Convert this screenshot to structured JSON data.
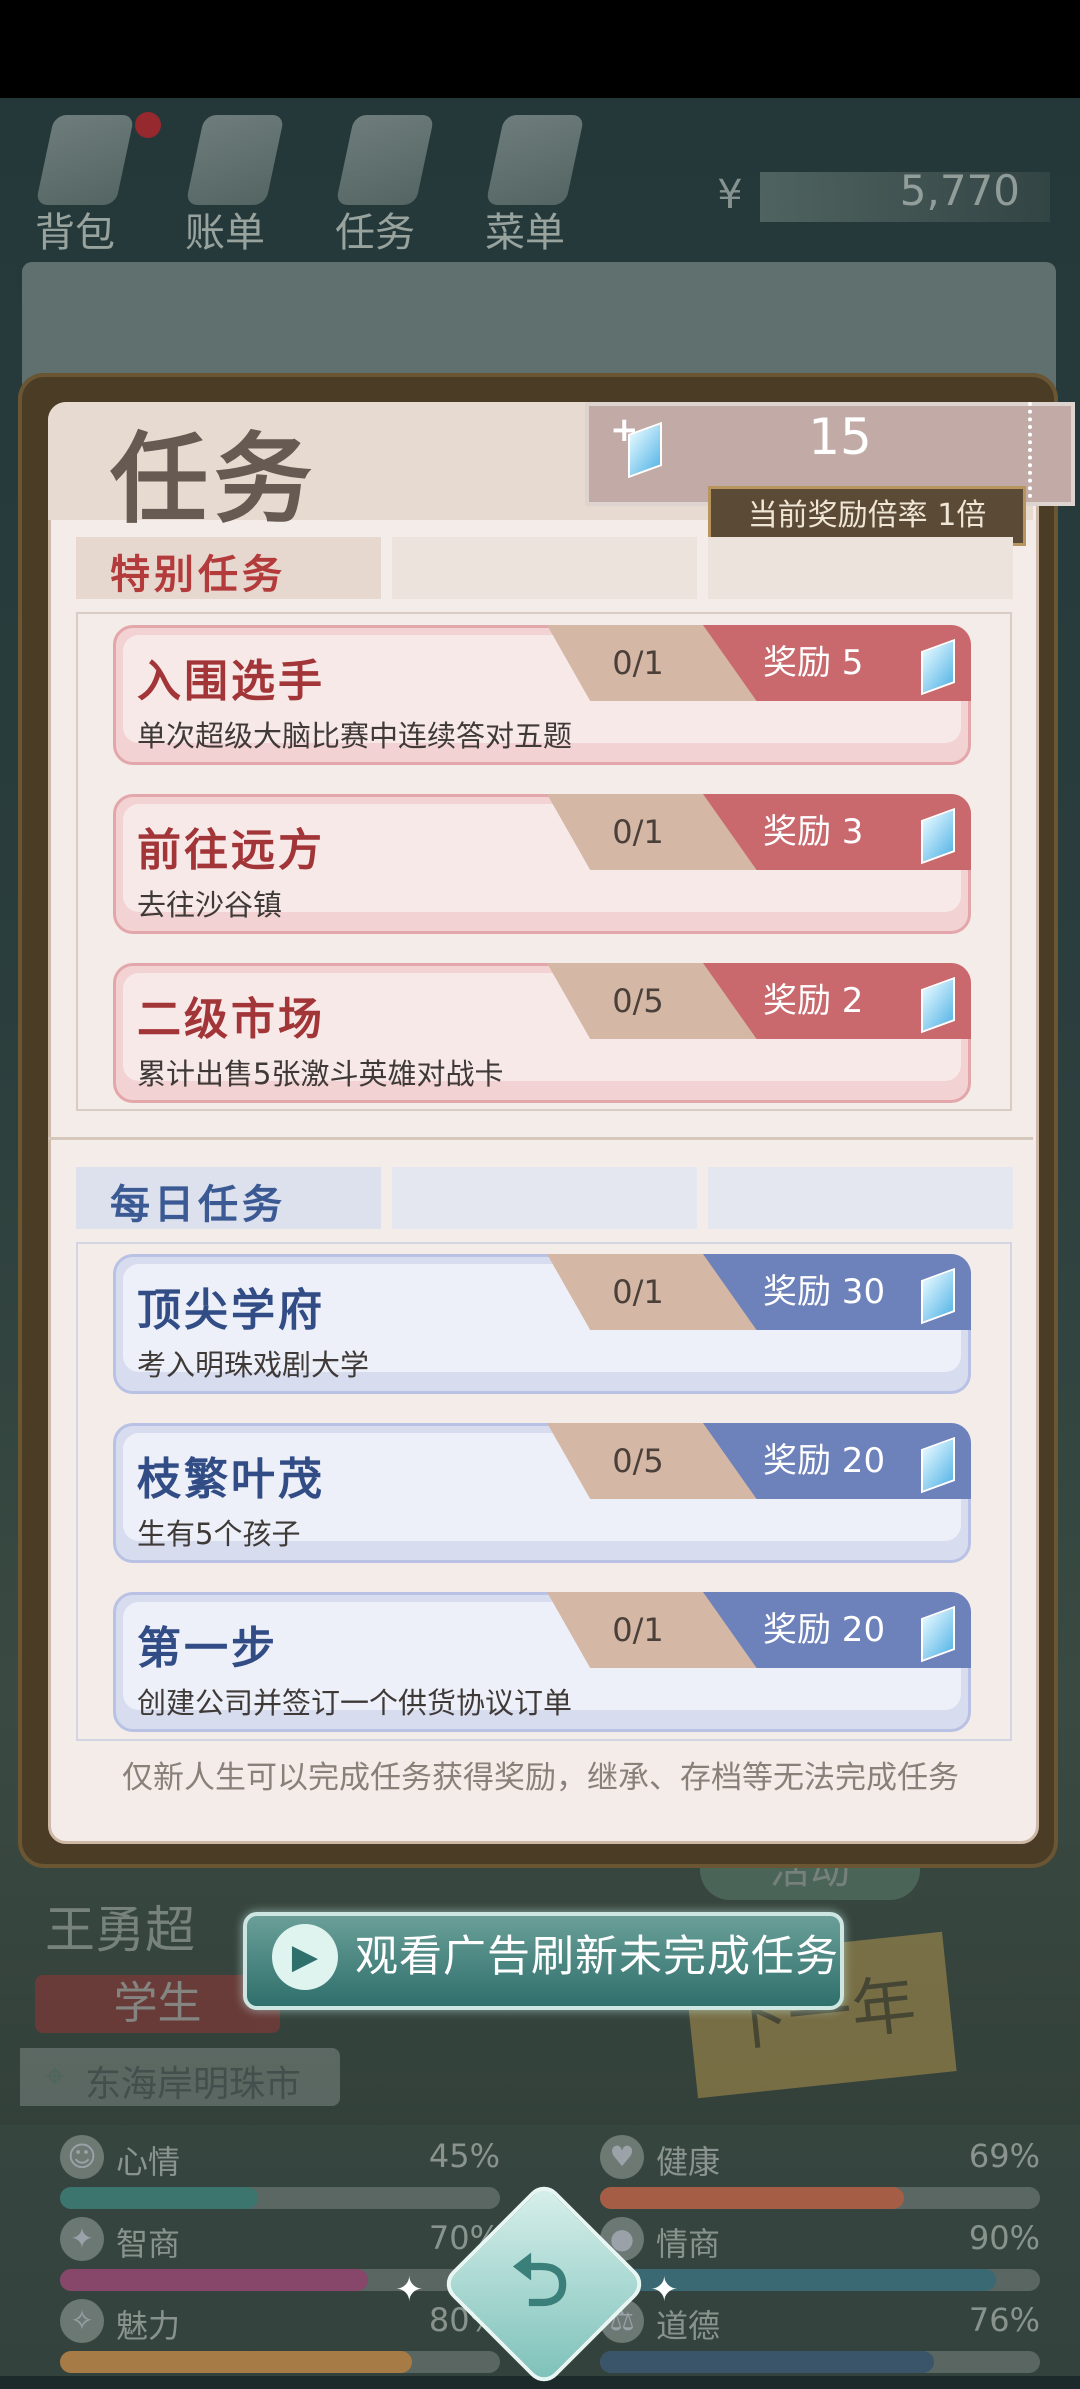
{
  "topnav": {
    "items": [
      {
        "label": "背包"
      },
      {
        "label": "账单"
      },
      {
        "label": "任务"
      },
      {
        "label": "菜单"
      }
    ],
    "money_symbol": "¥",
    "money_value": "5,770"
  },
  "background": {
    "name": "王勇超",
    "role": "学生",
    "location": "东海岸明珠市",
    "activity": "活动",
    "next_year": "下一年",
    "stats": [
      {
        "label": "心情",
        "value": "45%",
        "fraction": 0.45,
        "color": "#2f7a73"
      },
      {
        "label": "健康",
        "value": "69%",
        "fraction": 0.69,
        "color": "#c45a3a"
      },
      {
        "label": "智商",
        "value": "70%",
        "fraction": 0.7,
        "color": "#9a3b6e"
      },
      {
        "label": "情商",
        "value": "90%",
        "fraction": 0.9,
        "color": "#2e6a7a"
      },
      {
        "label": "魅力",
        "value": "80%",
        "fraction": 0.8,
        "color": "#c7853a"
      },
      {
        "label": "道德",
        "value": "76%",
        "fraction": 0.76,
        "color": "#2d4f6e"
      }
    ]
  },
  "modal": {
    "title": "任务",
    "gem_count": "15",
    "gem_plus": "+",
    "multiplier_text": "当前奖励倍率 1倍",
    "special_title": "特别任务",
    "daily_title": "每日任务",
    "special_tasks": [
      {
        "name": "入围选手",
        "desc": "单次超级大脑比赛中连续答对五题",
        "progress": "0/1",
        "reward": "奖励 5"
      },
      {
        "name": "前往远方",
        "desc": "去往沙谷镇",
        "progress": "0/1",
        "reward": "奖励 3"
      },
      {
        "name": "二级市场",
        "desc": "累计出售5张激斗英雄对战卡",
        "progress": "0/5",
        "reward": "奖励 2"
      }
    ],
    "daily_tasks": [
      {
        "name": "顶尖学府",
        "desc": "考入明珠戏剧大学",
        "progress": "0/1",
        "reward": "奖励 30"
      },
      {
        "name": "枝繁叶茂",
        "desc": "生有5个孩子",
        "progress": "0/5",
        "reward": "奖励 20"
      },
      {
        "name": "第一步",
        "desc": "创建公司并签订一个供货协议订单",
        "progress": "0/1",
        "reward": "奖励 20"
      }
    ],
    "footer_note": "仅新人生可以完成任务获得奖励，继承、存档等无法完成任务"
  },
  "ad_button": {
    "label": "观看广告刷新未完成任务"
  },
  "colors": {
    "special_accent": "#a23537",
    "daily_accent": "#324d86",
    "reward_red": "#c9696d",
    "reward_blue": "#6d81bb"
  }
}
